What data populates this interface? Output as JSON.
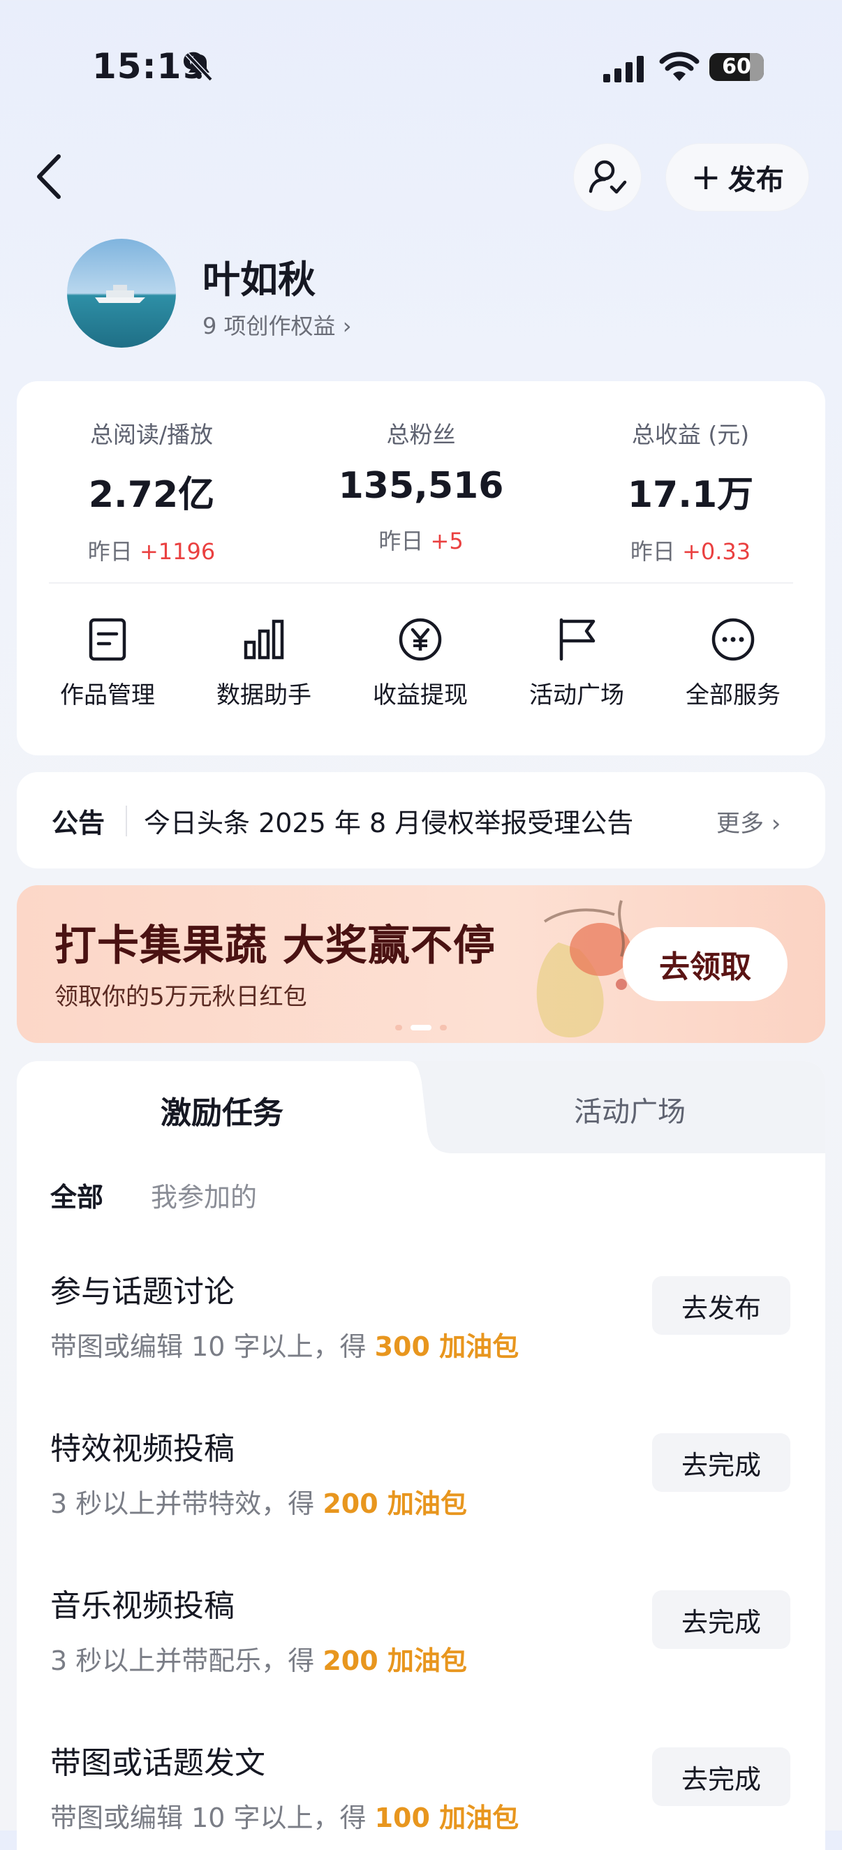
{
  "status_bar": {
    "time": "15:19",
    "battery": "60"
  },
  "header": {
    "publish_label": "发布"
  },
  "profile": {
    "name": "叶如秋",
    "rights": "9 项创作权益 ›"
  },
  "stats": [
    {
      "label": "总阅读/播放",
      "value": "2.72亿",
      "delta_prefix": "昨日 ",
      "delta": "+1196"
    },
    {
      "label": "总粉丝",
      "value": "135,516",
      "delta_prefix": "昨日 ",
      "delta": "+5"
    },
    {
      "label": "总收益 (元)",
      "value": "17.1万",
      "delta_prefix": "昨日 ",
      "delta": "+0.33"
    }
  ],
  "services": [
    {
      "label": "作品管理",
      "icon": "document-icon"
    },
    {
      "label": "数据助手",
      "icon": "bar-chart-icon"
    },
    {
      "label": "收益提现",
      "icon": "yen-icon"
    },
    {
      "label": "活动广场",
      "icon": "flag-icon"
    },
    {
      "label": "全部服务",
      "icon": "more-icon"
    }
  ],
  "notice": {
    "label": "公告",
    "text": "今日头条 2025 年 8 月侵权举报受理公告",
    "more": "更多 ›"
  },
  "banner": {
    "title": "打卡集果蔬 大奖赢不停",
    "subtitle": "领取你的5万元秋日红包",
    "button": "去领取"
  },
  "tasks_panel": {
    "tabs": [
      "激励任务",
      "活动广场"
    ],
    "filters": [
      "全部",
      "我参加的"
    ],
    "items": [
      {
        "title": "参与话题讨论",
        "desc": "带图或编辑 10 字以上，得 ",
        "reward": "300 加油包",
        "button": "去发布"
      },
      {
        "title": "特效视频投稿",
        "desc": "3 秒以上并带特效，得 ",
        "reward": "200 加油包",
        "button": "去完成"
      },
      {
        "title": "音乐视频投稿",
        "desc": "3 秒以上并带配乐，得 ",
        "reward": "200 加油包",
        "button": "去完成"
      },
      {
        "title": "带图或话题发文",
        "desc": "带图或编辑 10 字以上，得 ",
        "reward": "100 加油包",
        "button": "去完成"
      }
    ]
  },
  "colors": {
    "accent_red": "#ea4040",
    "reward_orange": "#e8961e",
    "banner_title": "#4a1212"
  }
}
